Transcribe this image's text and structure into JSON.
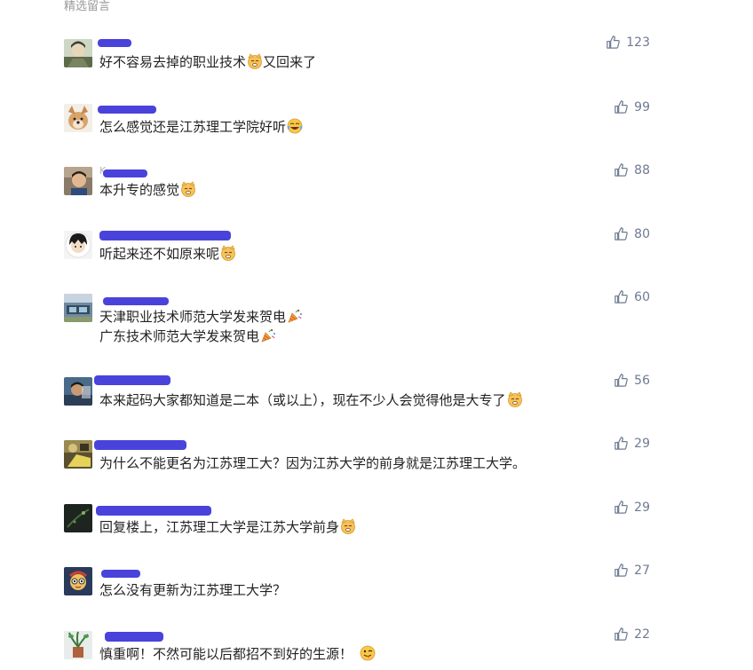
{
  "section_title": "精选留言",
  "comments": [
    {
      "nickname": "",
      "content": [
        "好不容易去掉的职业技术",
        "又回来了"
      ],
      "emoji": [
        "cat-face",
        null
      ],
      "likes": "123"
    },
    {
      "nickname": "",
      "content": [
        "怎么感觉还是江苏理工学院好听"
      ],
      "emoji": [
        "laughing-tears"
      ],
      "likes": "99"
    },
    {
      "nickname": "K",
      "content": [
        "本升专的感觉"
      ],
      "emoji": [
        "cat-face"
      ],
      "likes": "88"
    },
    {
      "nickname": "",
      "content": [
        "听起来还不如原来呢"
      ],
      "emoji": [
        "cat-face"
      ],
      "likes": "80"
    },
    {
      "nickname": "",
      "content": [
        "天津职业技术师范大学发来贺电",
        "广东技术师范大学发来贺电"
      ],
      "emoji": [
        "party-popper",
        "party-popper"
      ],
      "likes": "60"
    },
    {
      "nickname": "",
      "content": [
        "本来起码大家都知道是二本（或以上），现在不少人会觉得他是大专了"
      ],
      "emoji": [
        "cat-face"
      ],
      "likes": "56"
    },
    {
      "nickname": "",
      "content": [
        "为什么不能更名为江苏理工大？因为江苏大学的前身就是江苏理工大学。"
      ],
      "emoji": [
        null
      ],
      "likes": "29"
    },
    {
      "nickname": "",
      "content": [
        "回复楼上，江苏理工大学是江苏大学前身"
      ],
      "emoji": [
        "cat-face"
      ],
      "likes": "29"
    },
    {
      "nickname": "",
      "content": [
        "怎么没有更新为江苏理工大学？"
      ],
      "emoji": [
        null
      ],
      "likes": "27"
    },
    {
      "nickname": "",
      "content": [
        "慎重啊！不然可能以后都招不到好的生源！"
      ],
      "emoji": [
        "winking-tongue"
      ],
      "likes": "22"
    }
  ]
}
